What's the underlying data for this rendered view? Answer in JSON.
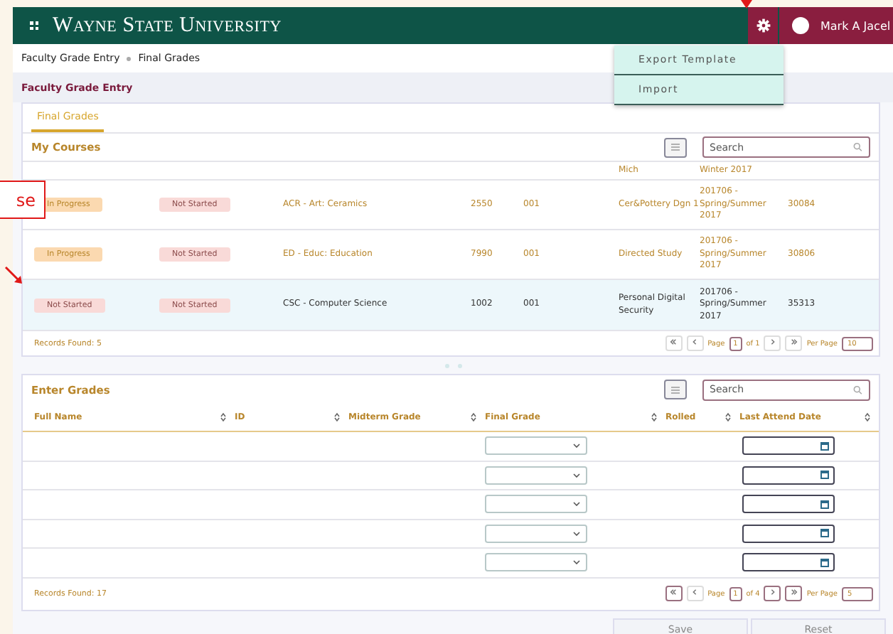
{
  "header": {
    "brand": "Wayne State University",
    "user": "Mark A Jacel"
  },
  "settings_menu": {
    "items": [
      "Export Template",
      "Import"
    ]
  },
  "breadcrumb": [
    "Faculty Grade Entry",
    "Final Grades"
  ],
  "page_title": "Faculty Grade Entry",
  "tabs": [
    {
      "label": "Final Grades",
      "selected": true
    }
  ],
  "courses": {
    "title": "My Courses",
    "search": {
      "placeholder": "Search"
    },
    "partial_row": {
      "title": "Mich",
      "term": "Winter 2017"
    },
    "rows": [
      {
        "midterm": "In Progress",
        "kind": "progress",
        "final": "Not Started",
        "subject": "ACR - Art: Ceramics",
        "course": "2550",
        "section": "001",
        "title": "Cer&Pottery Dgn 1",
        "term": "201706 - Spring/Summer 2017",
        "crn": "30084",
        "selected": false
      },
      {
        "midterm": "In Progress",
        "kind": "progress",
        "final": "Not Started",
        "subject": "ED - Educ: Education",
        "course": "7990",
        "section": "001",
        "title": "Directed Study",
        "term": "201706 - Spring/Summer 2017",
        "crn": "30806",
        "selected": false
      },
      {
        "midterm": "Not Started",
        "kind": "not_started",
        "final": "Not Started",
        "subject": "CSC - Computer Science",
        "course": "1002",
        "section": "001",
        "title": "Personal Digital Security",
        "term": "201706 - Spring/Summer 2017",
        "crn": "35313",
        "selected": true
      }
    ],
    "records": "Records Found: 5",
    "pager": {
      "page_label": "Page",
      "page": "1",
      "of": "of 1",
      "per_page_label": "Per Page",
      "per_page": "10"
    }
  },
  "grades": {
    "title": "Enter Grades",
    "search": {
      "placeholder": "Search"
    },
    "columns": [
      "Full Name",
      "ID",
      "Midterm Grade",
      "Final Grade",
      "Rolled",
      "Last Attend Date"
    ],
    "records": "Records Found: 17",
    "pager": {
      "page_label": "Page",
      "page": "1",
      "of": "of 4",
      "per_page_label": "Per Page",
      "per_page": "5"
    }
  },
  "buttons": [
    "Save",
    "Reset"
  ],
  "callout": {
    "text": "se"
  }
}
